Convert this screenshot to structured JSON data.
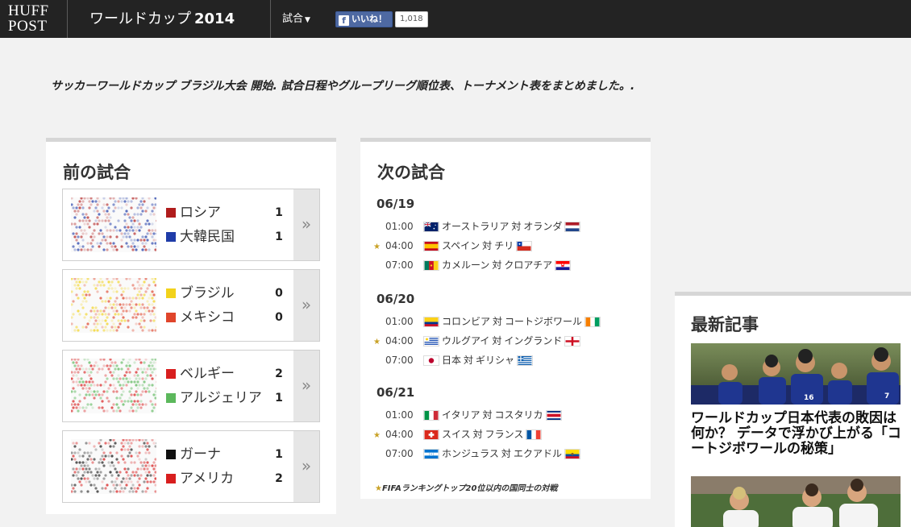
{
  "header": {
    "logo_line1": "HUFF",
    "logo_line2": "POST",
    "title": "ワールドカップ",
    "title_year": "2014",
    "nav_matches": "試合",
    "fb_like": "いいね！",
    "fb_count": "1,018"
  },
  "intro": "サッカーワールドカップ ブラジル大会 開始. 試合日程やグループリーグ順位表、トーナメント表をまとめました。.",
  "previous": {
    "title": "前の試合",
    "more_symbol": "»",
    "matches": [
      {
        "team1": "ロシア",
        "score1": "1",
        "color1": "#b01c1c",
        "team2": "大韓民国",
        "score2": "1",
        "color2": "#1f3ca8"
      },
      {
        "team1": "ブラジル",
        "score1": "0",
        "color1": "#f2d21b",
        "team2": "メキシコ",
        "score2": "0",
        "color2": "#e0452b"
      },
      {
        "team1": "ベルギー",
        "score1": "2",
        "color1": "#d81e1e",
        "team2": "アルジェリア",
        "score2": "1",
        "color2": "#5cb85c"
      },
      {
        "team1": "ガーナ",
        "score1": "1",
        "color1": "#111111",
        "team2": "アメリカ",
        "score2": "2",
        "color2": "#d81e1e"
      }
    ]
  },
  "next": {
    "title": "次の試合",
    "days": [
      {
        "date": "06/19",
        "fixtures": [
          {
            "star": false,
            "time": "01:00",
            "team1": "オーストラリア",
            "vs": "対",
            "team2": "オランダ"
          },
          {
            "star": true,
            "time": "04:00",
            "team1": "スペイン",
            "vs": "対",
            "team2": "チリ"
          },
          {
            "star": false,
            "time": "07:00",
            "team1": "カメルーン",
            "vs": "対",
            "team2": "クロアチア"
          }
        ]
      },
      {
        "date": "06/20",
        "fixtures": [
          {
            "star": false,
            "time": "01:00",
            "team1": "コロンビア",
            "vs": "対",
            "team2": "コートジボワール"
          },
          {
            "star": true,
            "time": "04:00",
            "team1": "ウルグアイ",
            "vs": "対",
            "team2": "イングランド"
          },
          {
            "star": false,
            "time": "07:00",
            "team1": "日本",
            "vs": "対",
            "team2": "ギリシャ"
          }
        ]
      },
      {
        "date": "06/21",
        "fixtures": [
          {
            "star": false,
            "time": "01:00",
            "team1": "イタリア",
            "vs": "対",
            "team2": "コスタリカ"
          },
          {
            "star": true,
            "time": "04:00",
            "team1": "スイス",
            "vs": "対",
            "team2": "フランス"
          },
          {
            "star": false,
            "time": "07:00",
            "team1": "ホンジュラス",
            "vs": "対",
            "team2": "エクアドル"
          }
        ]
      }
    ],
    "footnote": "FIFAランキングトップ20位以内の国同士の対戦"
  },
  "latest": {
    "title": "最新記事",
    "article1_title": "ワールドカップ日本代表の敗因は何か？ データで浮かび上がる「コートジボワールの秘策」"
  },
  "colors": {
    "topbar_bg": "#232323",
    "page_bg": "#f2f2f2",
    "star": "#c9a227",
    "fb_blue": "#4e69a2"
  }
}
